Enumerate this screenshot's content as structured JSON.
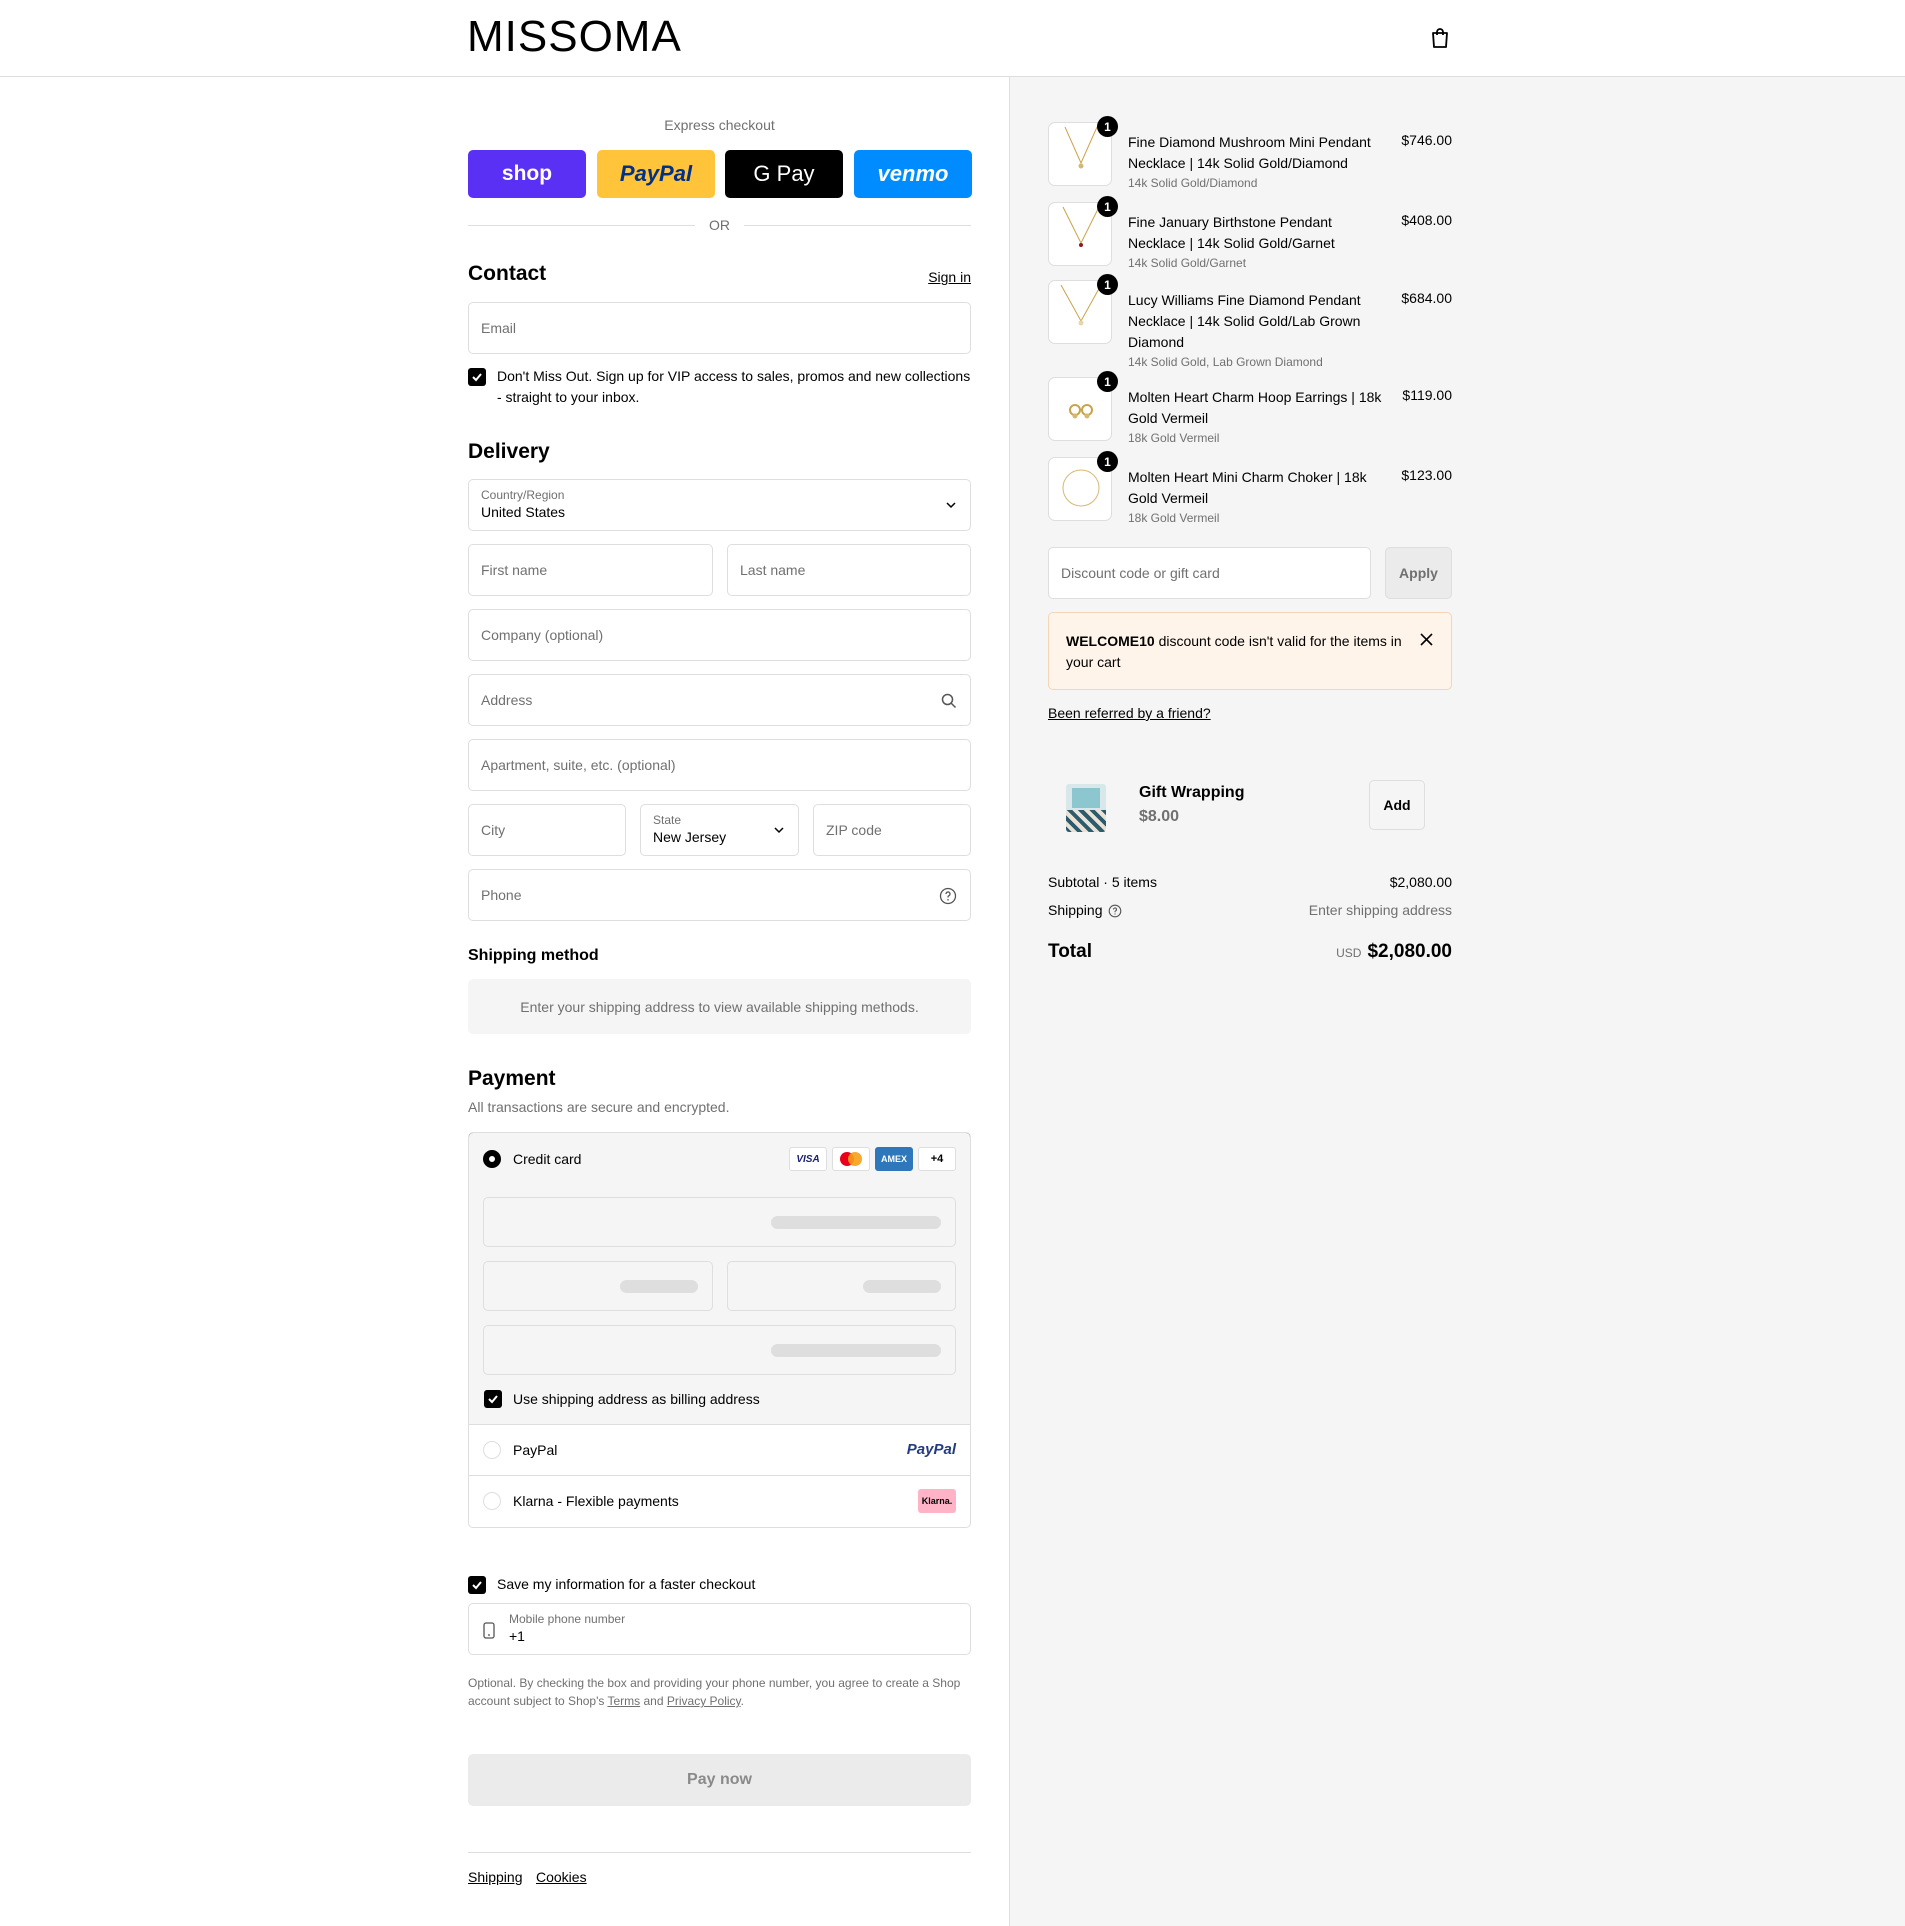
{
  "brand": "MISSOMA",
  "express": {
    "title": "Express checkout",
    "shop": "shop",
    "paypal": "PayPal",
    "gpay": "G Pay",
    "venmo": "venmo",
    "or": "OR"
  },
  "contact": {
    "heading": "Contact",
    "sign_in": "Sign in",
    "email_placeholder": "Email",
    "newsletter": "Don't Miss Out. Sign up for VIP access to sales, promos and new collections - straight to your inbox."
  },
  "delivery": {
    "heading": "Delivery",
    "country_label": "Country/Region",
    "country_value": "United States",
    "first_name": "First name",
    "last_name": "Last name",
    "company": "Company (optional)",
    "address": "Address",
    "apartment": "Apartment, suite, etc. (optional)",
    "city": "City",
    "state_label": "State",
    "state_value": "New Jersey",
    "zip": "ZIP code",
    "phone": "Phone"
  },
  "shipping_method": {
    "heading": "Shipping method",
    "message": "Enter your shipping address to view available shipping methods."
  },
  "payment": {
    "heading": "Payment",
    "subtitle": "All transactions are secure and encrypted.",
    "credit_card": "Credit card",
    "cards": [
      "VISA",
      "MC",
      "AMEX",
      "+4"
    ],
    "billing_same": "Use shipping address as billing address",
    "paypal": "PayPal",
    "paypal_logo": "PayPal",
    "klarna": "Klarna - Flexible payments",
    "klarna_logo": "Klarna."
  },
  "save_info": {
    "label": "Save my information for a faster checkout",
    "mobile_label": "Mobile phone number",
    "mobile_value": "+1",
    "legal_1": "Optional. By checking the box and providing your phone number, you agree to create a Shop account subject to Shop's ",
    "terms": "Terms",
    "and": " and ",
    "privacy": "Privacy Policy",
    "period": "."
  },
  "pay_now": "Pay now",
  "footer": {
    "shipping": "Shipping",
    "cookies": "Cookies"
  },
  "cart": {
    "items": [
      {
        "qty": "1",
        "name": "Fine Diamond Mushroom Mini Pendant Necklace | 14k Solid Gold/Diamond",
        "variant": "14k Solid Gold/Diamond",
        "price": "$746.00"
      },
      {
        "qty": "1",
        "name": "Fine January Birthstone Pendant Necklace | 14k Solid Gold/Garnet",
        "variant": "14k Solid Gold/Garnet",
        "price": "$408.00"
      },
      {
        "qty": "1",
        "name": "Lucy Williams Fine Diamond Pendant Necklace | 14k Solid Gold/Lab Grown Diamond",
        "variant": "14k Solid Gold, Lab Grown Diamond",
        "price": "$684.00"
      },
      {
        "qty": "1",
        "name": "Molten Heart Charm Hoop Earrings | 18k Gold Vermeil",
        "variant": "18k Gold Vermeil",
        "price": "$119.00"
      },
      {
        "qty": "1",
        "name": "Molten Heart Mini Charm Choker | 18k Gold Vermeil",
        "variant": "18k Gold Vermeil",
        "price": "$123.00"
      }
    ],
    "discount_placeholder": "Discount code or gift card",
    "apply": "Apply",
    "warning_code": "WELCOME10",
    "warning_text": " discount code isn't valid for the items in your cart",
    "referral": "Been referred by a friend?",
    "gift_title": "Gift Wrapping",
    "gift_price": "$8.00",
    "gift_add": "Add",
    "subtotal_label": "Subtotal · 5 items",
    "subtotal_value": "$2,080.00",
    "shipping_label": "Shipping",
    "shipping_value": "Enter shipping address",
    "total_label": "Total",
    "currency": "USD",
    "total_value": "$2,080.00"
  }
}
